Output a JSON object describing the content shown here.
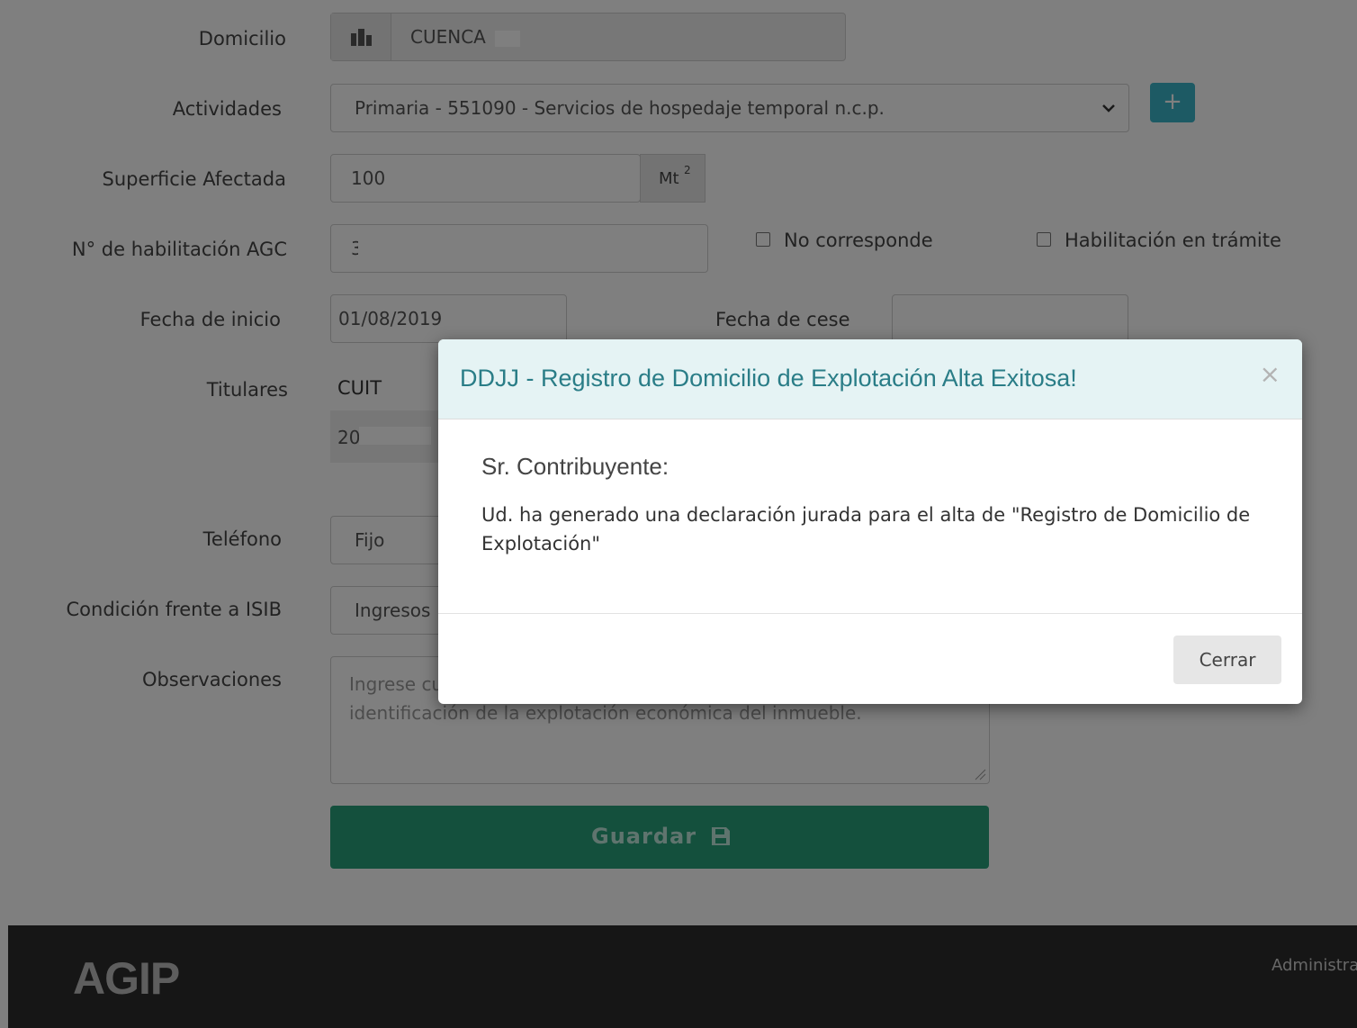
{
  "form": {
    "domicilio": {
      "label": "Domicilio",
      "value": "CUENCA"
    },
    "actividades": {
      "label": "Actividades",
      "value": "Primaria - 551090 - Servicios de hospedaje temporal n.c.p.",
      "add_label": "+"
    },
    "superficie": {
      "label": "Superficie Afectada",
      "value": "100",
      "unit": "Mt",
      "unit_sup": "2"
    },
    "habilitacion": {
      "label": "N° de habilitación AGC",
      "value": "3",
      "no_corresponde": "No corresponde",
      "en_tramite": "Habilitación en trámite"
    },
    "fecha_inicio": {
      "label": "Fecha de inicio",
      "value": "01/08/2019"
    },
    "fecha_cese": {
      "label": "Fecha de cese",
      "value": ""
    },
    "titulares": {
      "label": "Titulares",
      "column": "CUIT",
      "value": "20"
    },
    "telefono": {
      "label": "Teléfono",
      "value": "Fijo"
    },
    "isib": {
      "label": "Condición frente a ISIB",
      "value": "Ingresos"
    },
    "observaciones": {
      "label": "Observaciones",
      "placeholder": "Ingrese cualquier información que considere relevante para la identificación de la explotación económica del inmueble."
    },
    "save_label": "Guardar"
  },
  "footer": {
    "logo": "AGIP",
    "right_text": "Administra"
  },
  "modal": {
    "title": "DDJJ - Registro de Domicilio de Explotación Alta Exitosa!",
    "close_symbol": "×",
    "greeting": "Sr. Contribuyente:",
    "message": "Ud. ha generado una declaración jurada para el alta de \"Registro de Domicilio de Explotación\"",
    "close_button": "Cerrar"
  },
  "colors": {
    "accent": "#3bb4c9",
    "save": "#28a07a",
    "modal_title": "#2a7d87",
    "footer": "#2d2d2d"
  }
}
